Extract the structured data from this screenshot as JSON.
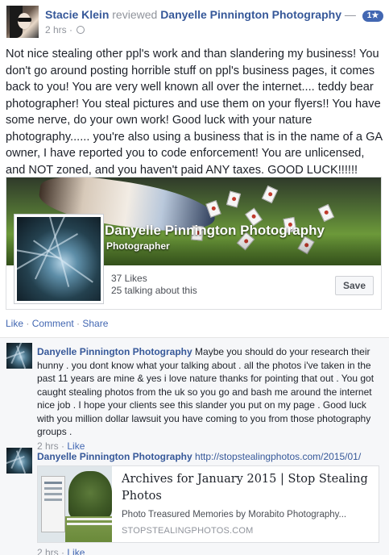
{
  "review": {
    "author": "Stacie Klein",
    "verb": "reviewed",
    "target": "Danyelle Pinnington Photography",
    "dash": "—",
    "rating": "1★",
    "time": "2 hrs",
    "dot": "·",
    "text": "Not nice stealing other ppl's work and than slandering my business! You don't go around posting horrible stuff on ppl's business pages, it comes back to you! You are very well known all over the internet.... teddy bear photographer! You steal pictures and use them on your flyers!! You have some nerve, do your own work! Good luck with your nature photography...... you're also using a business that is in the name of a GA owner, I have reported you to code enforcement! You are unlicensed, and NOT zoned, and you haven't paid ANY taxes. GOOD LUCK!!!!!!"
  },
  "page_card": {
    "name": "Danyelle Pinnington Photography",
    "category": "Photographer",
    "likes": "37 Likes",
    "talking": "25 talking about this",
    "save_label": "Save"
  },
  "actions": {
    "like": "Like",
    "comment": "Comment",
    "share": "Share",
    "sep": " · "
  },
  "comments": [
    {
      "author": "Danyelle Pinnington Photography",
      "text": "Maybe you should do your research their hunny . you dont know what your talking about . all the photos i've taken in the past 11 years are mine & yes i love nature thanks for pointing that out . You got caught stealing photos from the uk so you go and bash me around the internet nice job . I hope your clients see this slander you put on my page . Good luck with you million dollar lawsuit you have coming to you from those photography groups .",
      "time": "2 hrs",
      "like": "Like"
    },
    {
      "author": "Danyelle Pinnington Photography",
      "link_text": "http://stopstealingphotos.com/2015/01/",
      "time": "2 hrs",
      "like": "Like",
      "link_card": {
        "title": "Archives for January 2015 | Stop Stealing Photos",
        "description": "Photo Treasured Memories by Morabito Photography...",
        "domain": "STOPSTEALINGPHOTOS.COM"
      }
    }
  ],
  "colors": {
    "link": "#365899",
    "action": "#4267b2",
    "muted": "#90949c",
    "badge": "#4267b2"
  }
}
